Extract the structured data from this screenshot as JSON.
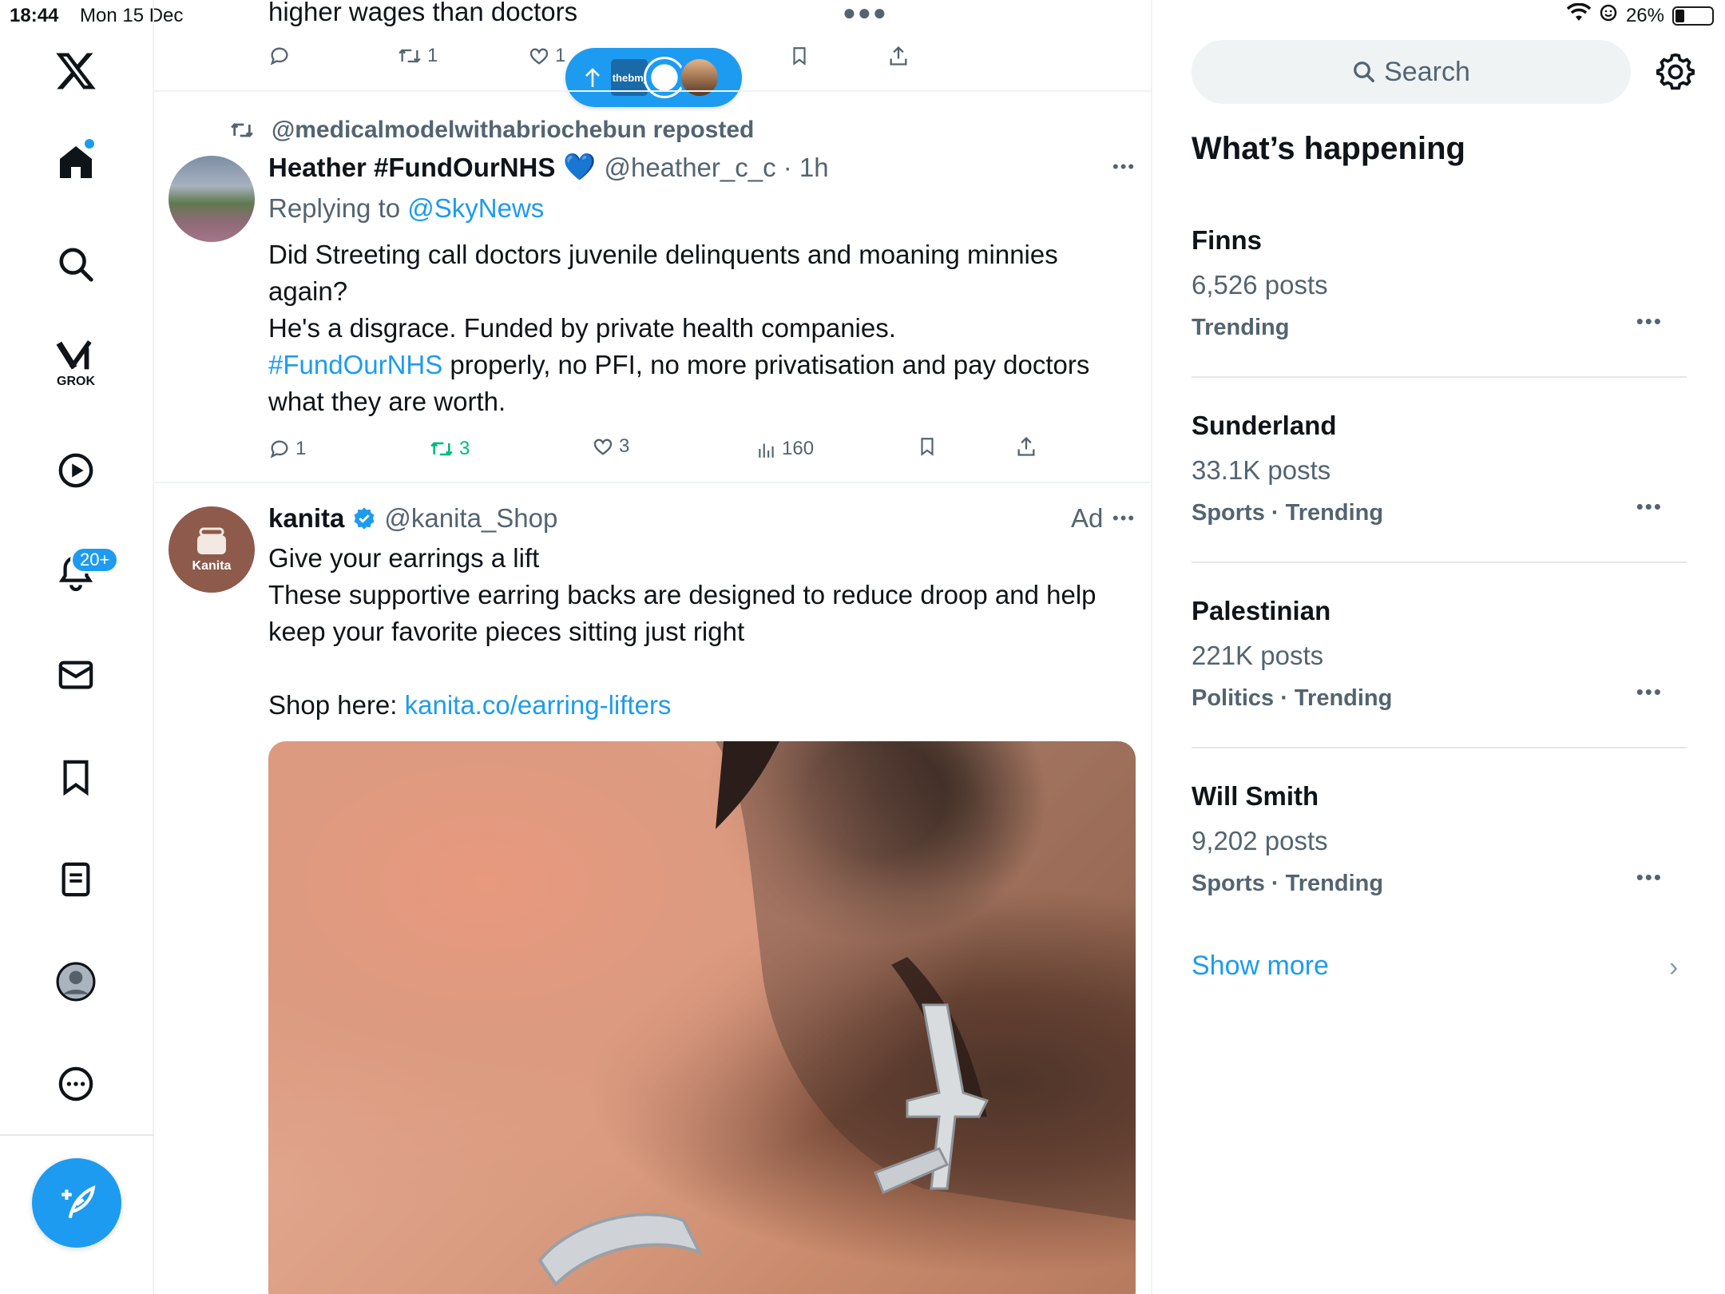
{
  "status": {
    "time": "18:44",
    "date": "Mon 15 Dec",
    "battery": "26%",
    "battery_level": 0.26
  },
  "nav": {
    "grok_label": "GROK",
    "notifications_badge": "20+"
  },
  "feed": {
    "top_post": {
      "text": "higher wages than doctors",
      "replies": "",
      "reposts": "1",
      "likes": "1"
    },
    "new_posts_pill": {
      "logo_text": "thebmj"
    },
    "post1": {
      "repost_by": "@medicalmodelwithabriochebun reposted",
      "name": "Heather #FundOurNHS",
      "name_emoji": "💙",
      "handle_time": "@heather_c_c · 1h",
      "replying_prefix": "Replying to ",
      "replying_to": "@SkyNews",
      "line1": "Did Streeting call doctors juvenile delinquents and moaning minnies",
      "line2": "again?",
      "line3": "He's a disgrace. Funded by private health companies.",
      "hashtag": "#FundOurNHS",
      "line4_rest": " properly, no PFI, no more privatisation and pay doctors",
      "line5": "what they are worth.",
      "replies": "1",
      "reposts": "3",
      "likes": "3",
      "views": "160"
    },
    "post2": {
      "name": "kanita",
      "handle": "@kanita_Shop",
      "ad_label": "Ad",
      "avatar_text": "Kanita",
      "line1": "Give your earrings a lift",
      "line2": "These supportive earring backs are designed to reduce droop and help",
      "line3": "keep your favorite pieces sitting just right",
      "shop_prefix": "Shop here: ",
      "shop_link": "kanita.co/earring-lifters"
    }
  },
  "sidebar": {
    "search_placeholder": "Search",
    "title": "What’s happening",
    "trends": [
      {
        "name": "Finns",
        "posts": "6,526 posts",
        "meta": "Trending"
      },
      {
        "name": "Sunderland",
        "posts": "33.1K posts",
        "meta": "Sports · Trending"
      },
      {
        "name": "Palestinian",
        "posts": "221K posts",
        "meta": "Politics · Trending"
      },
      {
        "name": "Will Smith",
        "posts": "9,202 posts",
        "meta": "Sports · Trending"
      }
    ],
    "show_more": "Show more"
  },
  "colors": {
    "accent": "#1d9bf0",
    "repost_green": "#00ba7c",
    "muted": "#536471"
  }
}
